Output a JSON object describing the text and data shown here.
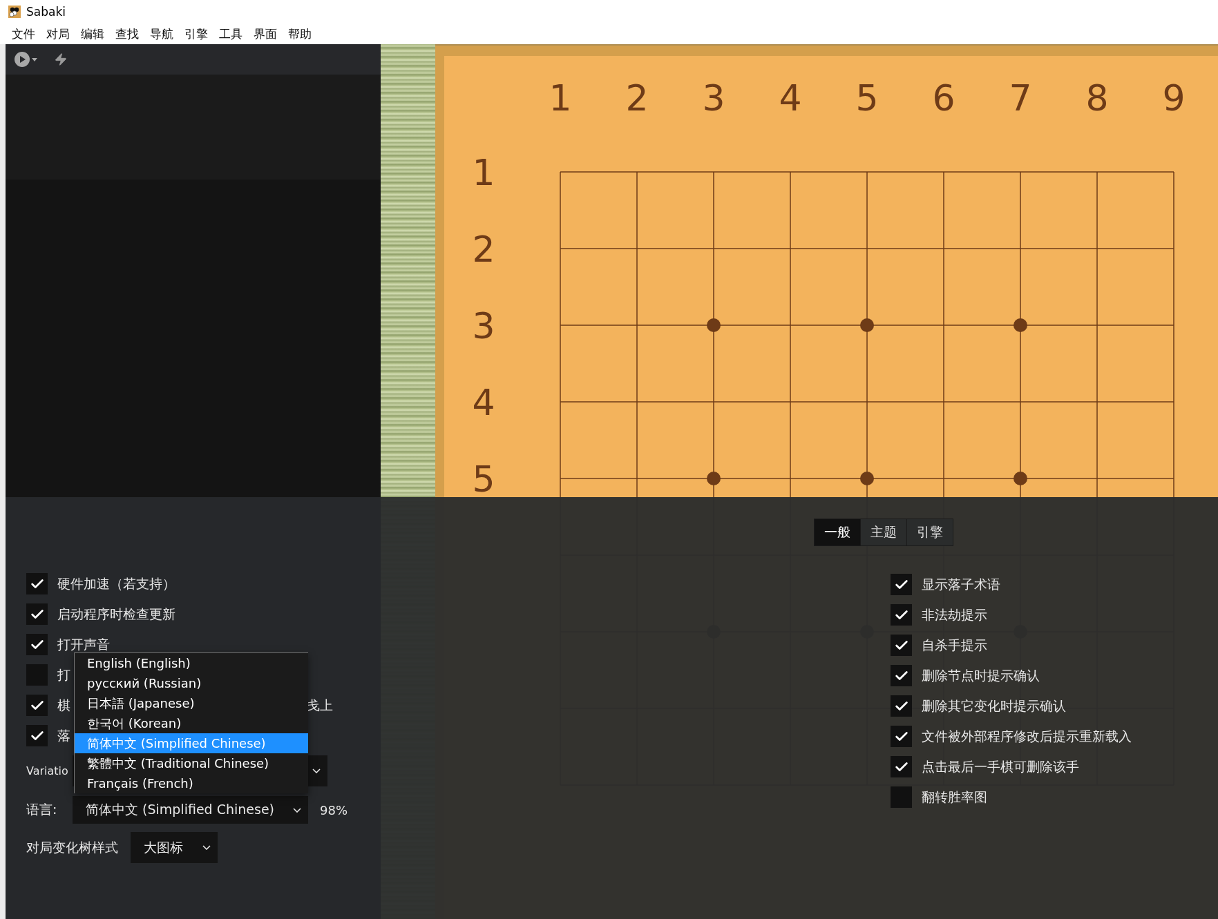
{
  "window": {
    "title": "Sabaki"
  },
  "menu": [
    "文件",
    "对局",
    "编辑",
    "查找",
    "导航",
    "引擎",
    "工具",
    "界面",
    "帮助"
  ],
  "board": {
    "column_labels": [
      "1",
      "2",
      "3",
      "4",
      "5",
      "6",
      "7",
      "8",
      "9"
    ],
    "row_labels": [
      "1",
      "2",
      "3",
      "4",
      "5"
    ]
  },
  "settings": {
    "tabs": [
      {
        "label": "一般",
        "selected": true
      },
      {
        "label": "主题",
        "selected": false
      },
      {
        "label": "引擎",
        "selected": false
      }
    ],
    "left_options": [
      {
        "label": "硬件加速（若支持）",
        "checked": true
      },
      {
        "label": "启动程序时检查更新",
        "checked": true
      },
      {
        "label": "打开声音",
        "checked": true
      },
      {
        "label": "打",
        "checked": false
      },
      {
        "label": "棋",
        "label_tail": "戋上",
        "checked": true
      },
      {
        "label": "落",
        "checked": true
      }
    ],
    "variation": {
      "label": "Variatio"
    },
    "language": {
      "label": "语言:",
      "value": "简体中文 (Simplified Chinese)",
      "percent": "98%"
    },
    "tree_style": {
      "label": "对局变化树样式",
      "value": "大图标"
    },
    "language_dropdown": [
      {
        "label": "English (English)",
        "selected": false
      },
      {
        "label": "русский (Russian)",
        "selected": false
      },
      {
        "label": "日本語 (Japanese)",
        "selected": false
      },
      {
        "label": "한국어 (Korean)",
        "selected": false
      },
      {
        "label": "简体中文 (Simplified Chinese)",
        "selected": true
      },
      {
        "label": "繁體中文 (Traditional Chinese)",
        "selected": false
      },
      {
        "label": "Français (French)",
        "selected": false
      }
    ],
    "right_options": [
      {
        "label": "显示落子术语",
        "checked": true
      },
      {
        "label": "非法劫提示",
        "checked": true
      },
      {
        "label": "自杀手提示",
        "checked": true
      },
      {
        "label": "删除节点时提示确认",
        "checked": true
      },
      {
        "label": "删除其它变化时提示确认",
        "checked": true
      },
      {
        "label": "文件被外部程序修改后提示重新载入",
        "checked": true
      },
      {
        "label": "点击最后一手棋可删除该手",
        "checked": true
      },
      {
        "label": "翻转胜率图",
        "checked": false
      }
    ]
  }
}
